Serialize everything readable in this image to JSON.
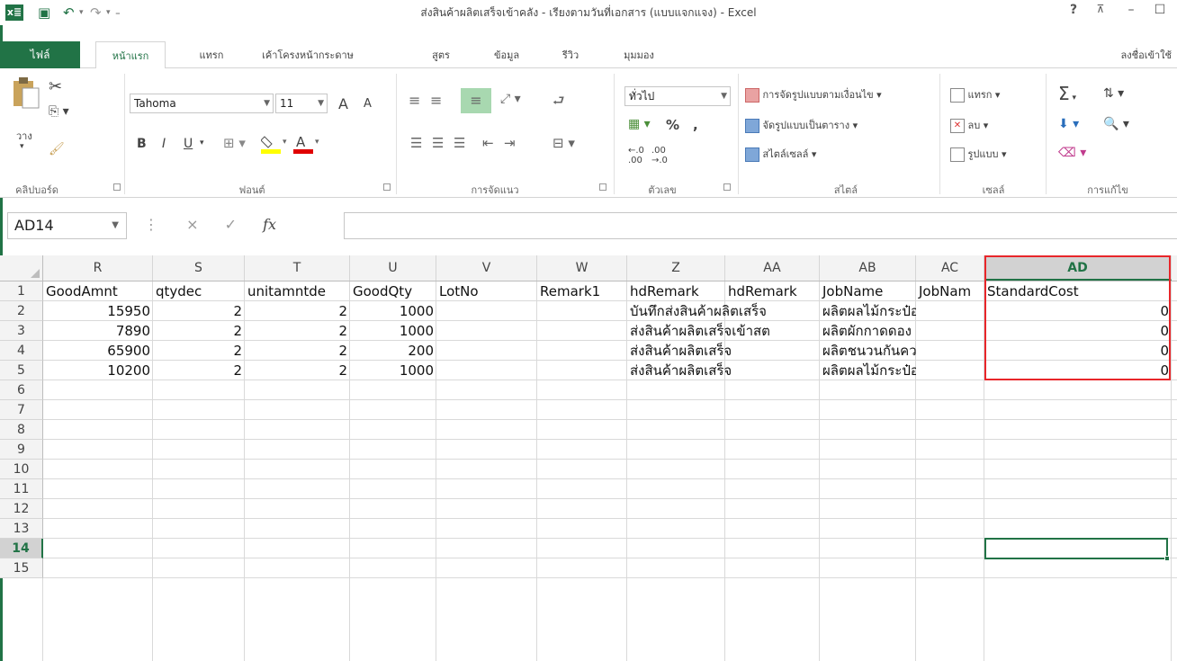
{
  "window": {
    "title": "ส่งสินค้าผลิตเสร็จเข้าคลัง - เรียงตามวันที่เอกสาร (แบบแจกแจง) - Excel",
    "help": "?",
    "restore_icon": "ribbon-display-icon",
    "minimize": "–",
    "maximize": "☐"
  },
  "tabs": {
    "file": "ไฟล์",
    "items": [
      "หน้าแรก",
      "แทรก",
      "เค้าโครงหน้ากระดาษ",
      "สูตร",
      "ข้อมูล",
      "รีวิว",
      "มุมมอง"
    ],
    "active": "หน้าแรก",
    "signin": "ลงชื่อเข้าใช้"
  },
  "ribbon": {
    "clipboard": {
      "paste": "วาง",
      "label": "คลิปบอร์ด"
    },
    "font": {
      "name": "Tahoma",
      "size": "11",
      "bold": "B",
      "italic": "I",
      "underline": "U",
      "grow": "A",
      "shrink": "A",
      "label": "ฟอนต์"
    },
    "alignment": {
      "label": "การจัดแนว"
    },
    "number": {
      "format": "ทั่วไป",
      "percent": "%",
      "comma": ",",
      "label": "ตัวเลข"
    },
    "styles": {
      "conditional": "การจัดรูปแบบตามเงื่อนไข",
      "format_table": "จัดรูปแบบเป็นตาราง",
      "cell_styles": "สไตล์เซลล์",
      "label": "สไตล์"
    },
    "cells": {
      "insert": "แทรก",
      "delete": "ลบ",
      "format": "รูปแบบ",
      "label": "เซลล์"
    },
    "editing": {
      "sum": "Σ",
      "label": "การแก้ไข"
    },
    "accent": "#217346"
  },
  "formula_bar": {
    "name_box": "AD14",
    "cancel": "×",
    "enter": "✓",
    "fx": "fx",
    "content": ""
  },
  "grid": {
    "columns": [
      "R",
      "S",
      "T",
      "U",
      "V",
      "W",
      "Z",
      "AA",
      "AB",
      "AC",
      "AD"
    ],
    "selected_column": "AD",
    "row_numbers": [
      "1",
      "2",
      "3",
      "4",
      "5",
      "6",
      "7",
      "8",
      "9",
      "10",
      "11",
      "12",
      "13",
      "14",
      "15"
    ],
    "selected_row": "14",
    "rows": [
      [
        "GoodAmnt",
        "qtydec",
        "unitamntde",
        "GoodQty",
        "LotNo",
        "Remark1",
        "hdRemark",
        "hdRemark",
        "JobName",
        "JobNam",
        "StandardCost"
      ],
      [
        "15950",
        "2",
        "2",
        "1000",
        "",
        "",
        "บันทึกส่งสินค้าผลิตเสร็จ",
        "",
        "ผลิตผลไม้กระป๋อง",
        "",
        "0"
      ],
      [
        "7890",
        "2",
        "2",
        "1000",
        "",
        "",
        "ส่งสินค้าผลิตเสร็จเข้าสต",
        "",
        "ผลิตผักกาดดอง",
        "",
        "0"
      ],
      [
        "65900",
        "2",
        "2",
        "200",
        "",
        "",
        "ส่งสินค้าผลิตเสร็จ",
        "",
        "ผลิตชนวนกันความร้",
        "",
        "0"
      ],
      [
        "10200",
        "2",
        "2",
        "1000",
        "",
        "",
        "ส่งสินค้าผลิตเสร็จ",
        "",
        "ผลิตผลไม้กระป๋อง",
        "",
        "0"
      ]
    ],
    "highlight_color": "#e8262a"
  }
}
